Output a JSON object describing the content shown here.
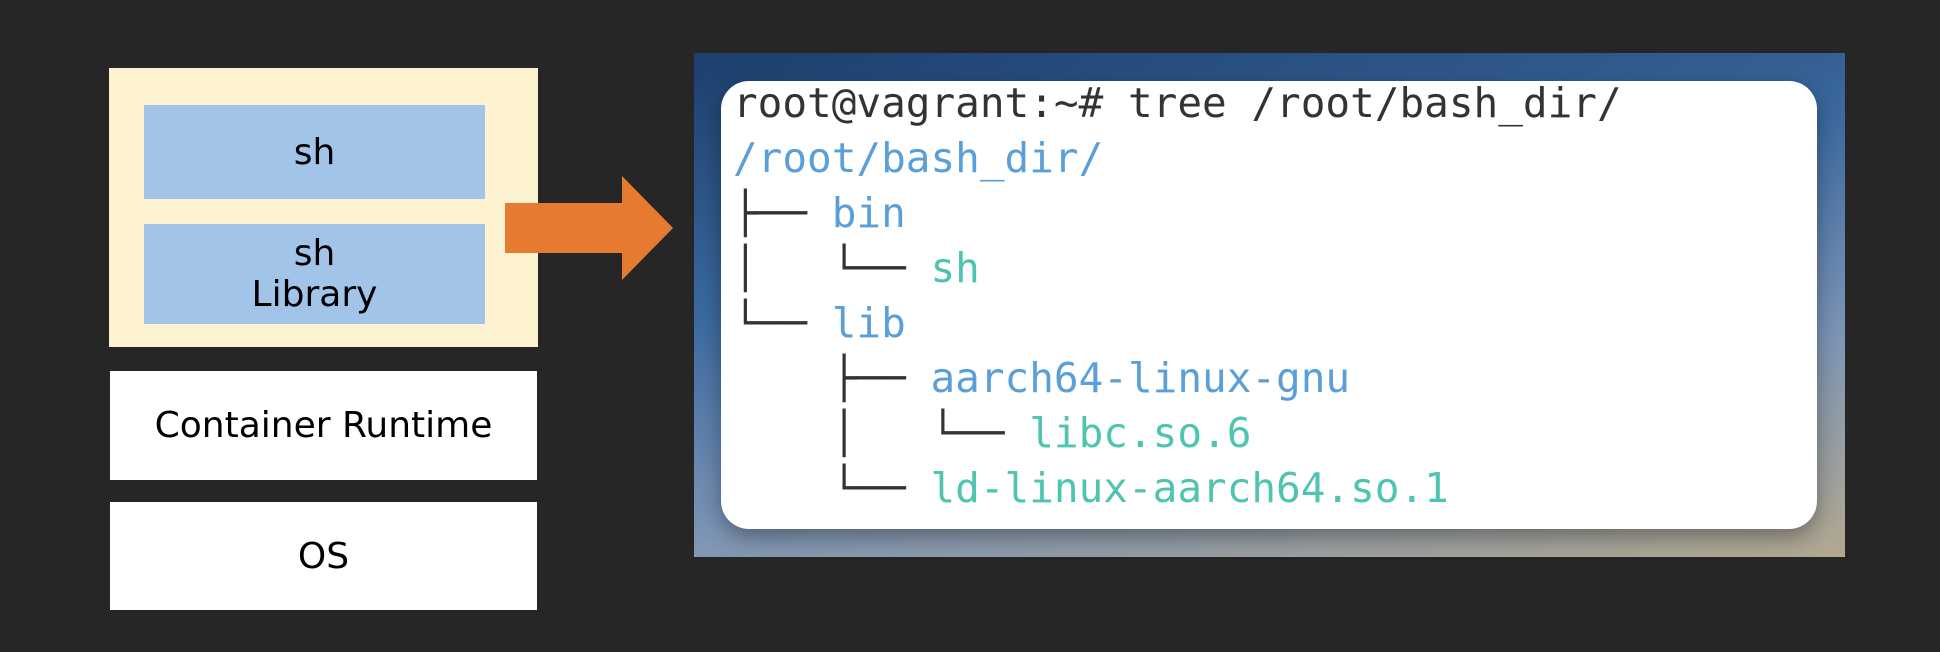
{
  "left_stack": {
    "container_layers": [
      {
        "lines": [
          "sh"
        ]
      },
      {
        "lines": [
          "sh",
          "Library"
        ]
      }
    ],
    "runtime_label": "Container Runtime",
    "os_label": "OS"
  },
  "arrow": {
    "color": "#e57a30"
  },
  "terminal": {
    "prompt_line": "root@vagrant:~# tree /root/bash_dir/",
    "tree": [
      {
        "prefix": "",
        "name": "/root/bash_dir/",
        "kind": "dir"
      },
      {
        "prefix": "├── ",
        "name": "bin",
        "kind": "dir"
      },
      {
        "prefix": "│   └── ",
        "name": "sh",
        "kind": "file"
      },
      {
        "prefix": "└── ",
        "name": "lib",
        "kind": "dir"
      },
      {
        "prefix": "    ├── ",
        "name": "aarch64-linux-gnu",
        "kind": "dir"
      },
      {
        "prefix": "    │   └── ",
        "name": "libc.so.6",
        "kind": "file"
      },
      {
        "prefix": "    └── ",
        "name": "ld-linux-aarch64.so.1",
        "kind": "file"
      }
    ]
  },
  "colors": {
    "background": "#262626",
    "container_bg": "#fdf2cf",
    "layer_bg": "#a2c4e8",
    "dir_color": "#5a9fd8",
    "file_color": "#4fc4b0"
  }
}
